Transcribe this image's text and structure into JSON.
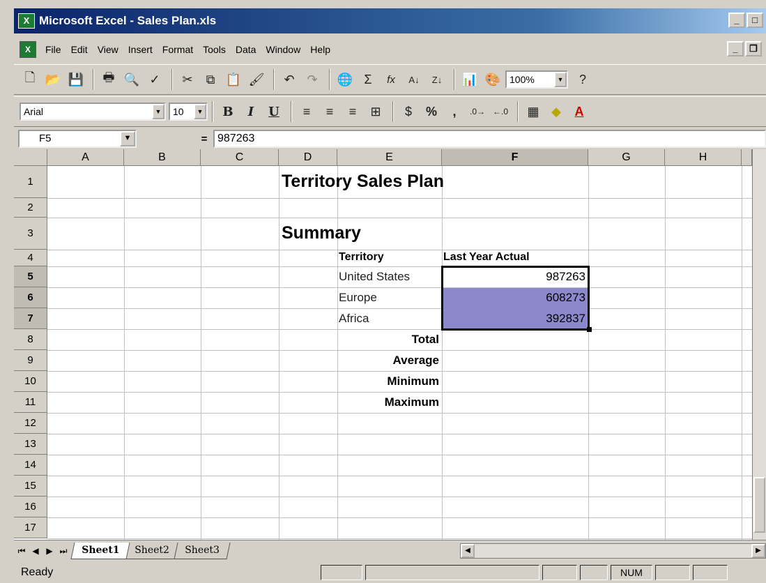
{
  "window": {
    "title": "Microsoft Excel - Sales Plan.xls"
  },
  "menu": [
    "File",
    "Edit",
    "View",
    "Insert",
    "Format",
    "Tools",
    "Data",
    "Window",
    "Help"
  ],
  "toolbar": {
    "zoom": "100%",
    "font_name": "Arial",
    "font_size": "10",
    "bold": "B",
    "italic": "I",
    "underline": "U",
    "percent": "%",
    "comma": ","
  },
  "formula_bar": {
    "name_box": "F5",
    "equals": "=",
    "value": "987263"
  },
  "columns": [
    "A",
    "B",
    "C",
    "D",
    "E",
    "F",
    "G",
    "H"
  ],
  "rows": [
    "1",
    "2",
    "3",
    "4",
    "5",
    "6",
    "7",
    "8",
    "9",
    "10",
    "11",
    "12",
    "13",
    "14",
    "15",
    "16",
    "17"
  ],
  "sheet": {
    "title": "Territory Sales Plan",
    "subtitle": "Summary",
    "header_territory": "Territory",
    "header_last_year": "Last Year Actual",
    "rows": [
      {
        "territory": "United States",
        "value": "987263"
      },
      {
        "territory": "Europe",
        "value": "608273"
      },
      {
        "territory": "Africa",
        "value": "392837"
      }
    ],
    "labels": [
      "Total",
      "Average",
      "Minimum",
      "Maximum"
    ]
  },
  "tabs": [
    "Sheet1",
    "Sheet2",
    "Sheet3"
  ],
  "status": {
    "text": "Ready",
    "num": "NUM"
  },
  "colors": {
    "title_bar": "#0a246a",
    "selection": "#8c88cc",
    "chrome": "#d4d0c8"
  }
}
